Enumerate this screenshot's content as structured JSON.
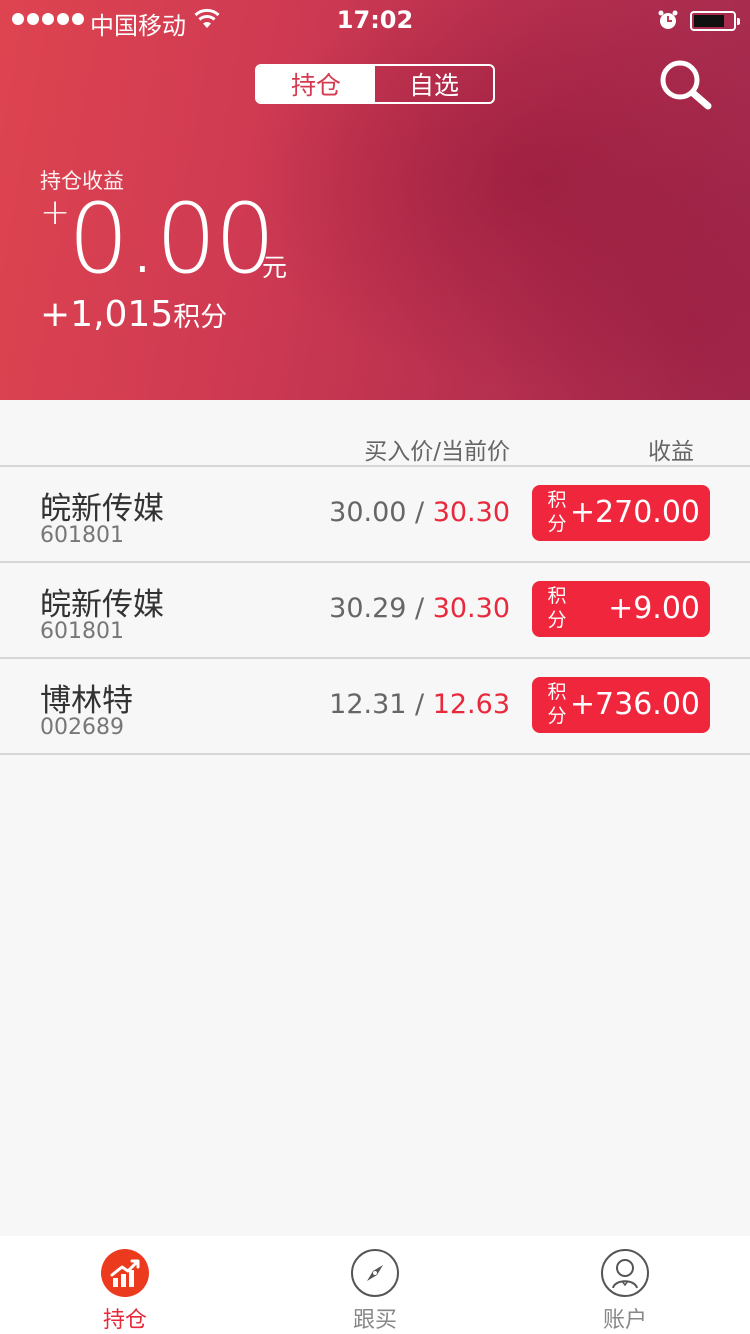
{
  "status_bar": {
    "carrier": "中国移动",
    "time": "17:02"
  },
  "header": {
    "tabs": [
      {
        "label": "持仓",
        "active": true
      },
      {
        "label": "自选",
        "active": false
      }
    ],
    "profit_label": "持仓收益",
    "profit_sign": "+",
    "profit_amount": "0.00",
    "profit_unit": "元",
    "points_value": "+1,015",
    "points_unit": "积分"
  },
  "table": {
    "col_price": "买入价/当前价",
    "col_profit": "收益",
    "badge_tag": "积分",
    "rows": [
      {
        "name": "皖新传媒",
        "code": "601801",
        "buy_price": "30.00",
        "current_price": "30.30",
        "profit": "+270.00"
      },
      {
        "name": "皖新传媒",
        "code": "601801",
        "buy_price": "30.29",
        "current_price": "30.30",
        "profit": "+9.00"
      },
      {
        "name": "博林特",
        "code": "002689",
        "buy_price": "12.31",
        "current_price": "12.63",
        "profit": "+736.00"
      }
    ]
  },
  "tabbar": {
    "items": [
      {
        "label": "持仓",
        "icon": "holdings-chart-icon",
        "active": true
      },
      {
        "label": "跟买",
        "icon": "compass-icon",
        "active": false
      },
      {
        "label": "账户",
        "icon": "user-icon",
        "active": false
      }
    ]
  },
  "colors": {
    "accent": "#e8283b",
    "badge": "#f0263d",
    "header_start": "#de4450",
    "header_end": "#a32a4e"
  }
}
